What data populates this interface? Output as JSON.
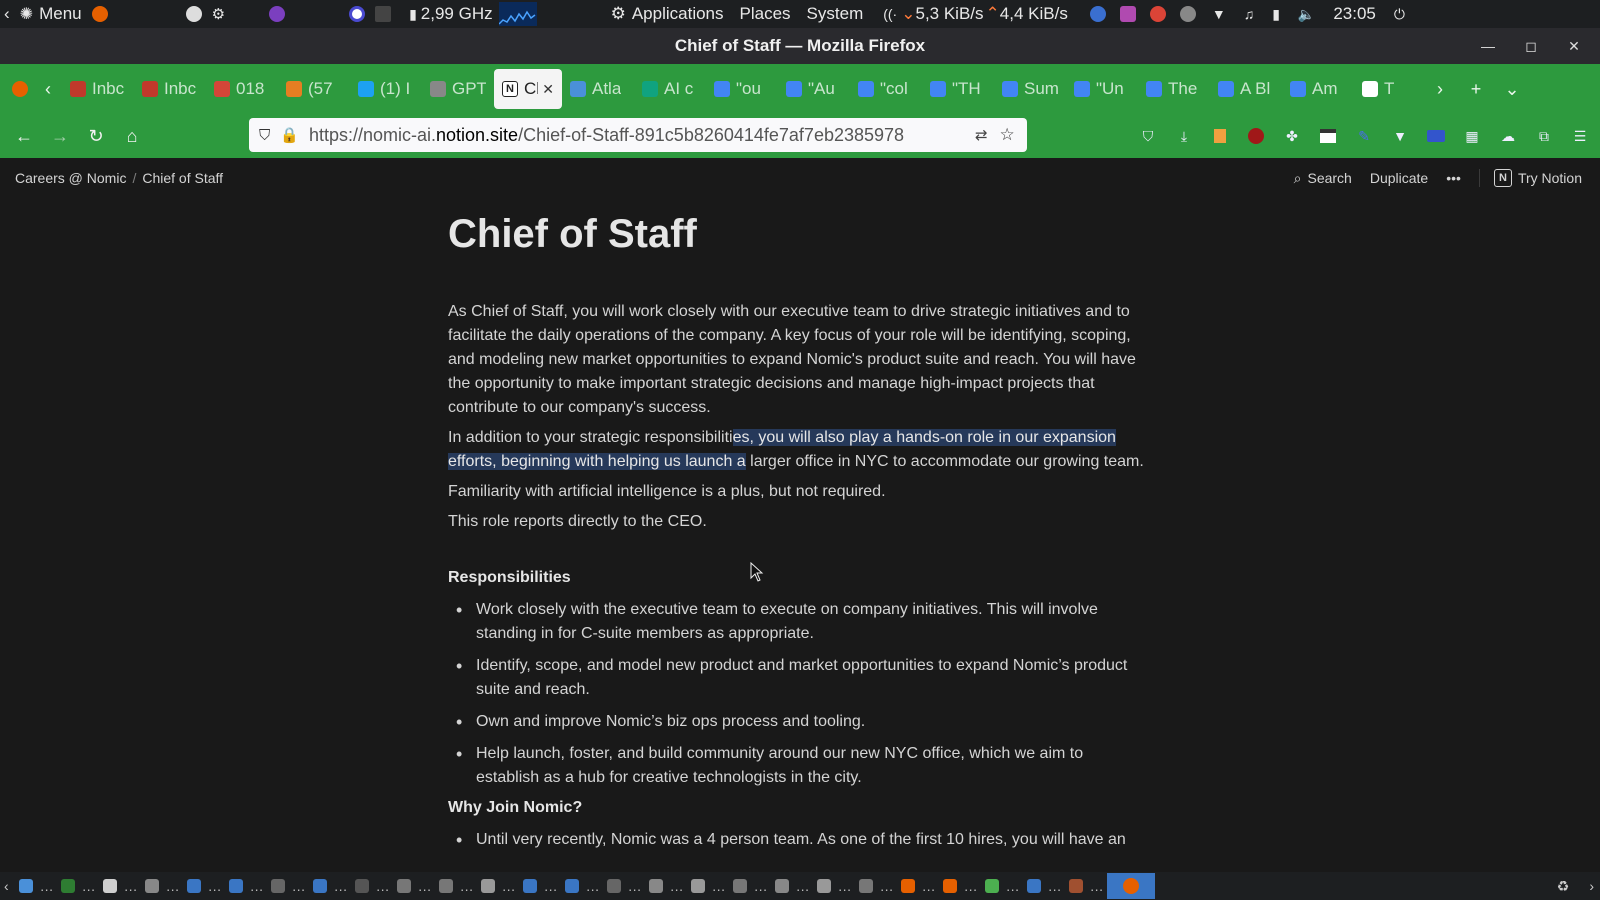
{
  "system_panel": {
    "menu_label": "Menu",
    "cpu_freq": "2,99 GHz",
    "applications": "Applications",
    "places": "Places",
    "system": "System",
    "net_down": "5,3 KiB/s",
    "net_up": "4,4 KiB/s",
    "clock": "23:05"
  },
  "window": {
    "title": "Chief of Staff — Mozilla Firefox"
  },
  "tabs": [
    {
      "label": "Inbc",
      "icon": "mail-icon",
      "color": "#c0392b"
    },
    {
      "label": "Inbc",
      "icon": "mail-icon",
      "color": "#c0392b"
    },
    {
      "label": "018",
      "icon": "gmail-icon",
      "color": "#d44638"
    },
    {
      "label": "(57",
      "icon": "fox-icon",
      "color": "#e67e22"
    },
    {
      "label": "(1) I",
      "icon": "twitter-icon",
      "color": "#1da1f2"
    },
    {
      "label": "GPT",
      "icon": "gear-icon",
      "color": "#888888"
    },
    {
      "label": "Ch",
      "icon": "notion-icon",
      "color": "#ffffff",
      "active": true
    },
    {
      "label": "Atla",
      "icon": "map-icon",
      "color": "#4a90d9"
    },
    {
      "label": "AI c",
      "icon": "openai-icon",
      "color": "#10a37f"
    },
    {
      "label": "\"ou",
      "icon": "google-icon",
      "color": "#4285f4"
    },
    {
      "label": "\"Au",
      "icon": "google-icon",
      "color": "#4285f4"
    },
    {
      "label": "\"col",
      "icon": "google-icon",
      "color": "#4285f4"
    },
    {
      "label": "\"TH",
      "icon": "google-icon",
      "color": "#4285f4"
    },
    {
      "label": "Sum",
      "icon": "google-icon",
      "color": "#4285f4"
    },
    {
      "label": "\"Un",
      "icon": "google-icon",
      "color": "#4285f4"
    },
    {
      "label": "The",
      "icon": "google-icon",
      "color": "#4285f4"
    },
    {
      "label": "A Bl",
      "icon": "google-icon",
      "color": "#4285f4"
    },
    {
      "label": "Am",
      "icon": "google-icon",
      "color": "#4285f4"
    },
    {
      "label": "T",
      "icon": "wikipedia-icon",
      "color": "#ffffff"
    }
  ],
  "url": {
    "prefix": "https://nomic-ai.",
    "domain": "notion.site",
    "path": "/Chief-of-Staff-891c5b8260414fe7af7eb2385978"
  },
  "notion": {
    "breadcrumb": [
      "Careers @ Nomic",
      "Chief of Staff"
    ],
    "search_label": "Search",
    "duplicate_label": "Duplicate",
    "more_label": "•••",
    "try_notion_label": "Try Notion",
    "title": "Chief of Staff",
    "paragraphs": {
      "p1": "As Chief of Staff, you will work closely with our executive team to drive strategic initiatives and to facilitate the daily operations of the company. A key focus of your role will be identifying, scoping, and modeling new market opportunities to expand Nomic's product suite and reach. You will have the opportunity to make important strategic decisions and manage high-impact projects that contribute to our company's success.",
      "p2_pre": "In addition to your strategic responsibiliti",
      "p2_hl": "es, you will also play a hands-on role in our expansion efforts, beginning with helping us launch a",
      "p2_post": " larger office in NYC to accommodate our growing team.",
      "p3": "Familiarity with artificial intelligence is a plus, but not required.",
      "p4": "This role reports directly to the CEO."
    },
    "responsibilities_heading": "Responsibilities",
    "responsibilities": [
      "Work closely with the executive team to execute on company initiatives. This will involve standing in for C-suite members as appropriate.",
      "Identify, scope, and model new product and market opportunities to expand Nomic’s product suite and reach.",
      "Own and improve Nomic’s biz ops process and tooling.",
      "Help launch, foster, and build community around our new NYC office, which we aim to establish as a hub for creative technologists in the city."
    ],
    "why_heading": "Why Join Nomic?",
    "why_items": [
      "Until very recently, Nomic was a 4 person team. As one of the first 10 hires, you will have an"
    ]
  },
  "colors": {
    "tab_green": "#2d9a3e",
    "page_bg": "#191919",
    "highlight": "#26395a"
  }
}
